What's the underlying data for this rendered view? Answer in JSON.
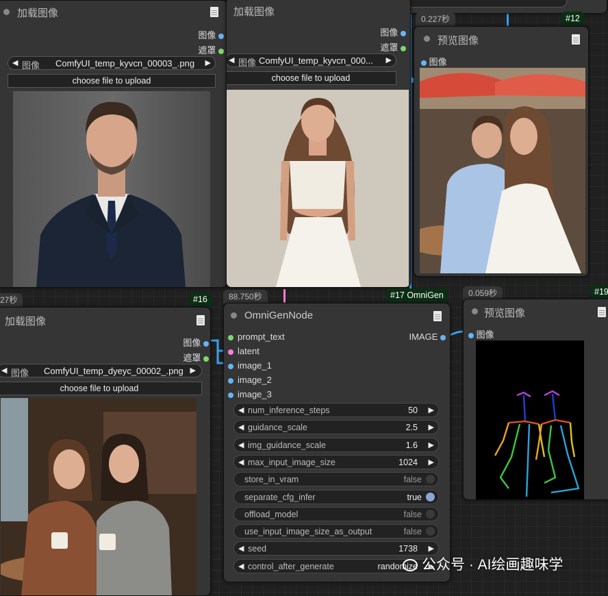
{
  "colors": {
    "canvas_bg": "#202020",
    "node_bg": "#353535",
    "socket_image": "#64b5f6",
    "socket_mask": "#7ed66f",
    "socket_latent": "#ff7fd5",
    "link_blue": "#3aa0ee",
    "id_badge_bg": "#0b2e14"
  },
  "top_partial_node": {
    "value": ""
  },
  "load_image_1": {
    "title": "加载图像",
    "outputs": [
      "图像",
      "遮罩"
    ],
    "combo_label": "图像",
    "combo_value": "ComfyUI_temp_kyvcn_00003_.png",
    "upload_label": "choose file to upload"
  },
  "load_image_2": {
    "title": "加载图像",
    "outputs": [
      "图像",
      "遮罩"
    ],
    "combo_label": "图像",
    "combo_value": "ComfyUI_temp_kyvcn_000...",
    "upload_label": "choose file to upload"
  },
  "preview_image_12": {
    "time": "0.227秒",
    "id": "#12",
    "title": "预览图像",
    "input": "图像"
  },
  "load_image_16": {
    "time": "27秒",
    "id": "#16",
    "title": "加载图像",
    "outputs": [
      "图像",
      "遮罩"
    ],
    "combo_label": "图像",
    "combo_value": "ComfyUI_temp_dyeyc_00002_.png",
    "upload_label": "choose file to upload"
  },
  "omnigen": {
    "time": "88.750秒",
    "id": "#17 OmniGen",
    "title": "OmniGenNode",
    "inputs": [
      {
        "name": "prompt_text",
        "color": "#7ed66f"
      },
      {
        "name": "latent",
        "color": "#ff7fd5"
      },
      {
        "name": "image_1",
        "color": "#64b5f6"
      },
      {
        "name": "image_2",
        "color": "#64b5f6"
      },
      {
        "name": "image_3",
        "color": "#64b5f6"
      }
    ],
    "output": "IMAGE",
    "widgets": [
      {
        "label": "num_inference_steps",
        "value": "50",
        "kind": "number"
      },
      {
        "label": "guidance_scale",
        "value": "2.5",
        "kind": "number"
      },
      {
        "label": "img_guidance_scale",
        "value": "1.6",
        "kind": "number"
      },
      {
        "label": "max_input_image_size",
        "value": "1024",
        "kind": "number"
      },
      {
        "label": "store_in_vram",
        "value": "false",
        "kind": "toggle"
      },
      {
        "label": "separate_cfg_infer",
        "value": "true",
        "kind": "toggle"
      },
      {
        "label": "offload_model",
        "value": "false",
        "kind": "toggle"
      },
      {
        "label": "use_input_image_size_as_output",
        "value": "false",
        "kind": "toggle"
      },
      {
        "label": "seed",
        "value": "1738",
        "kind": "number"
      },
      {
        "label": "control_after_generate",
        "value": "randomize",
        "kind": "number"
      }
    ]
  },
  "preview_image_19": {
    "time": "0.059秒",
    "id": "#19",
    "title": "预览图像",
    "input": "图像"
  },
  "watermark": "公众号 · AI绘画趣味学"
}
